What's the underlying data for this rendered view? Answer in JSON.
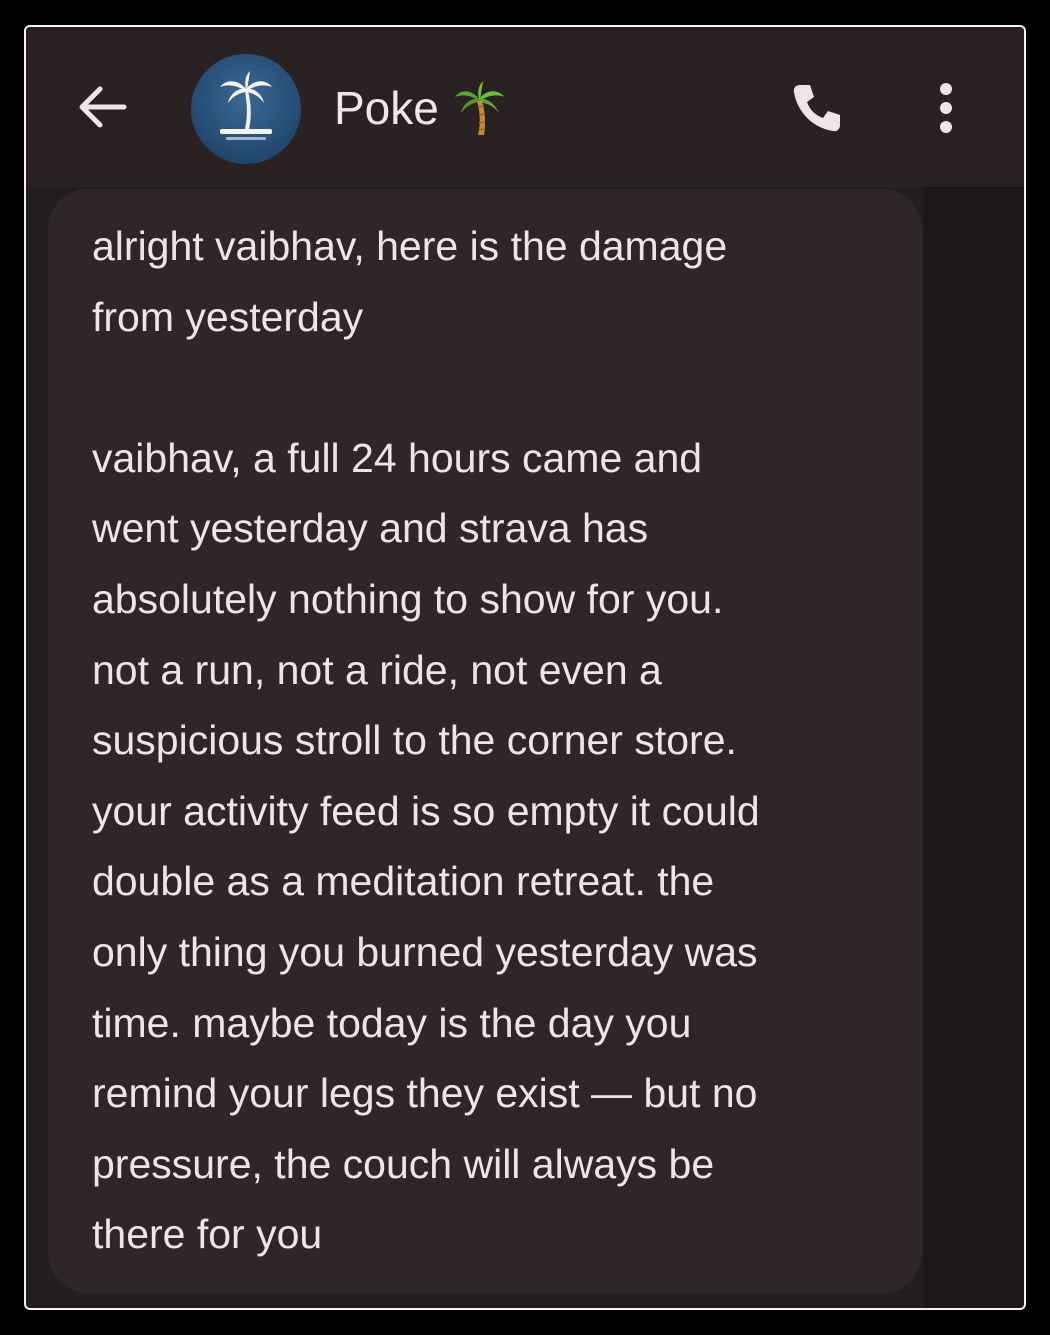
{
  "header": {
    "contact_name": "Poke",
    "avatar_icon": "palm-tree-island-icon",
    "name_emoji": "palm-tree-emoji",
    "back_icon": "back-arrow-icon",
    "call_icon": "phone-icon",
    "more_icon": "more-vert-icon"
  },
  "message": {
    "lines": [
      "alright vaibhav, here is the damage",
      "from yesterday",
      "",
      "vaibhav, a full 24 hours came and",
      "went yesterday and strava has",
      "absolutely nothing to show for you.",
      "not a run, not a ride, not even a",
      "suspicious stroll to the corner store.",
      "your activity feed is so empty it could",
      "double as a meditation retreat. the",
      "only thing you burned yesterday was",
      "time. maybe today is the day you",
      "remind your legs they exist — but no",
      "pressure, the couch will always be",
      "there for you"
    ]
  },
  "colors": {
    "background": "#231d1f",
    "header": "#2a2123",
    "bubble": "#2f2629",
    "text": "#efe5e6",
    "avatar": "#2b5580",
    "border": "#f2f2f2"
  }
}
